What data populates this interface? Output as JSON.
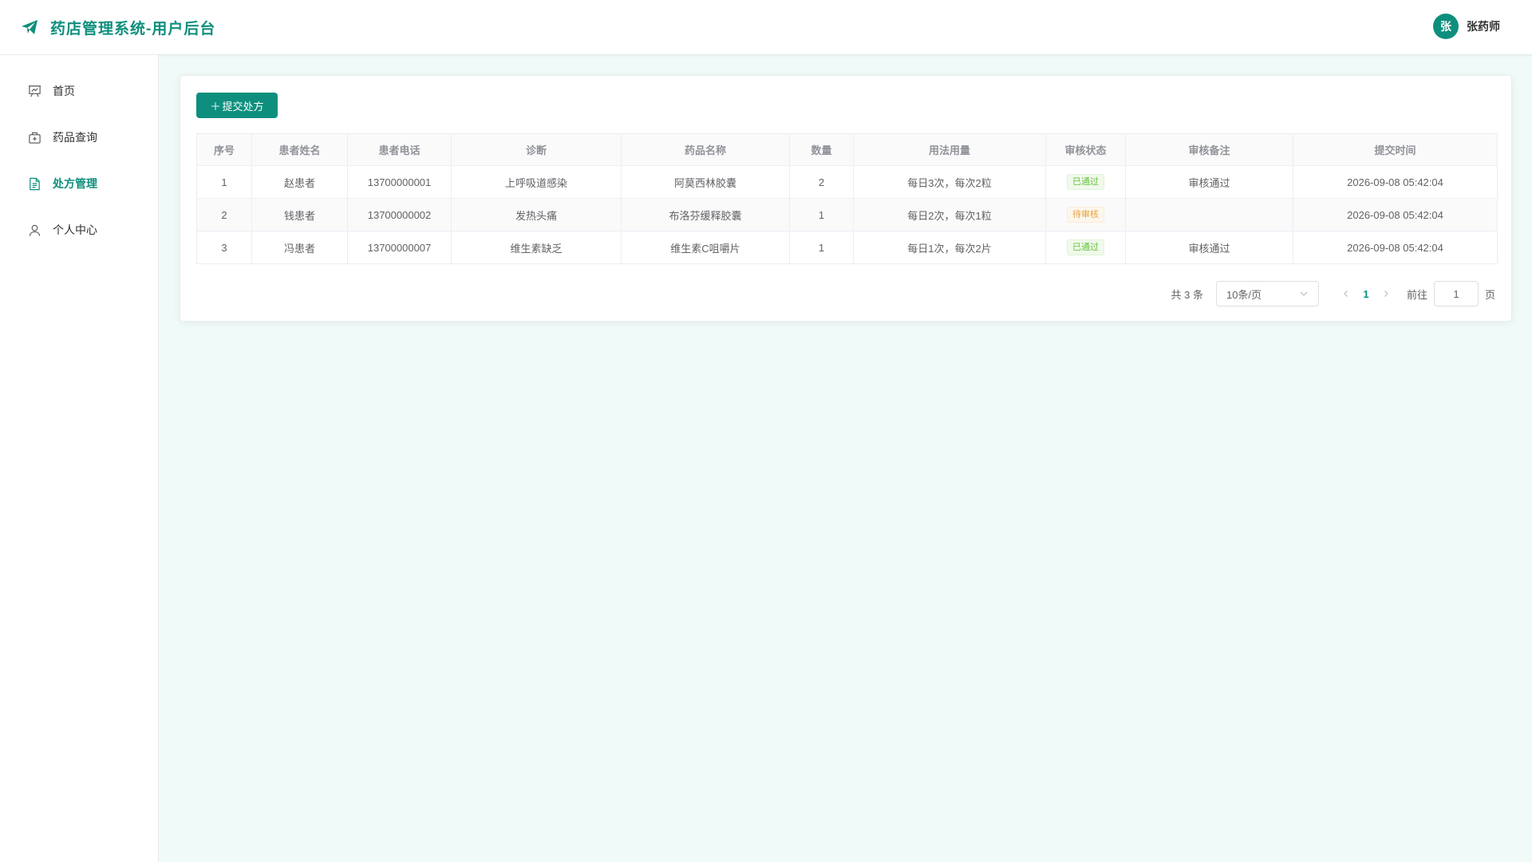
{
  "header": {
    "title": "药店管理系统-用户后台",
    "user_avatar": "张",
    "user_name": "张药师"
  },
  "sidebar": {
    "items": [
      {
        "label": "首页",
        "icon": "presentation-icon",
        "active": false
      },
      {
        "label": "药品查询",
        "icon": "medicine-box-icon",
        "active": false
      },
      {
        "label": "处方管理",
        "icon": "document-icon",
        "active": true
      },
      {
        "label": "个人中心",
        "icon": "user-icon",
        "active": false
      }
    ]
  },
  "toolbar": {
    "submit_label": "提交处方"
  },
  "table": {
    "columns": [
      "序号",
      "患者姓名",
      "患者电话",
      "诊断",
      "药品名称",
      "数量",
      "用法用量",
      "审核状态",
      "审核备注",
      "提交时间"
    ],
    "rows": [
      {
        "index": "1",
        "patient": "赵患者",
        "phone": "13700000001",
        "diagnosis": "上呼吸道感染",
        "drug": "阿莫西林胶囊",
        "qty": "2",
        "usage": "每日3次，每次2粒",
        "status": "已通过",
        "remark": "审核通过",
        "time": "2026-09-08 05:42:04"
      },
      {
        "index": "2",
        "patient": "钱患者",
        "phone": "13700000002",
        "diagnosis": "发热头痛",
        "drug": "布洛芬缓释胶囊",
        "qty": "1",
        "usage": "每日2次，每次1粒",
        "status": "待审核",
        "remark": "",
        "time": "2026-09-08 05:42:04"
      },
      {
        "index": "3",
        "patient": "冯患者",
        "phone": "13700000007",
        "diagnosis": "维生素缺乏",
        "drug": "维生素C咀嚼片",
        "qty": "1",
        "usage": "每日1次，每次2片",
        "status": "已通过",
        "remark": "审核通过",
        "time": "2026-09-08 05:42:04"
      }
    ]
  },
  "pagination": {
    "total": "共 3 条",
    "page_size": "10条/页",
    "current_page": "1",
    "goto_label": "前往",
    "goto_value": "1",
    "page_suffix": "页"
  },
  "colors": {
    "accent": "#0e8f7e",
    "status_pass": "#67c23a",
    "status_pending": "#e6a23c",
    "background": "#f0faf8"
  }
}
